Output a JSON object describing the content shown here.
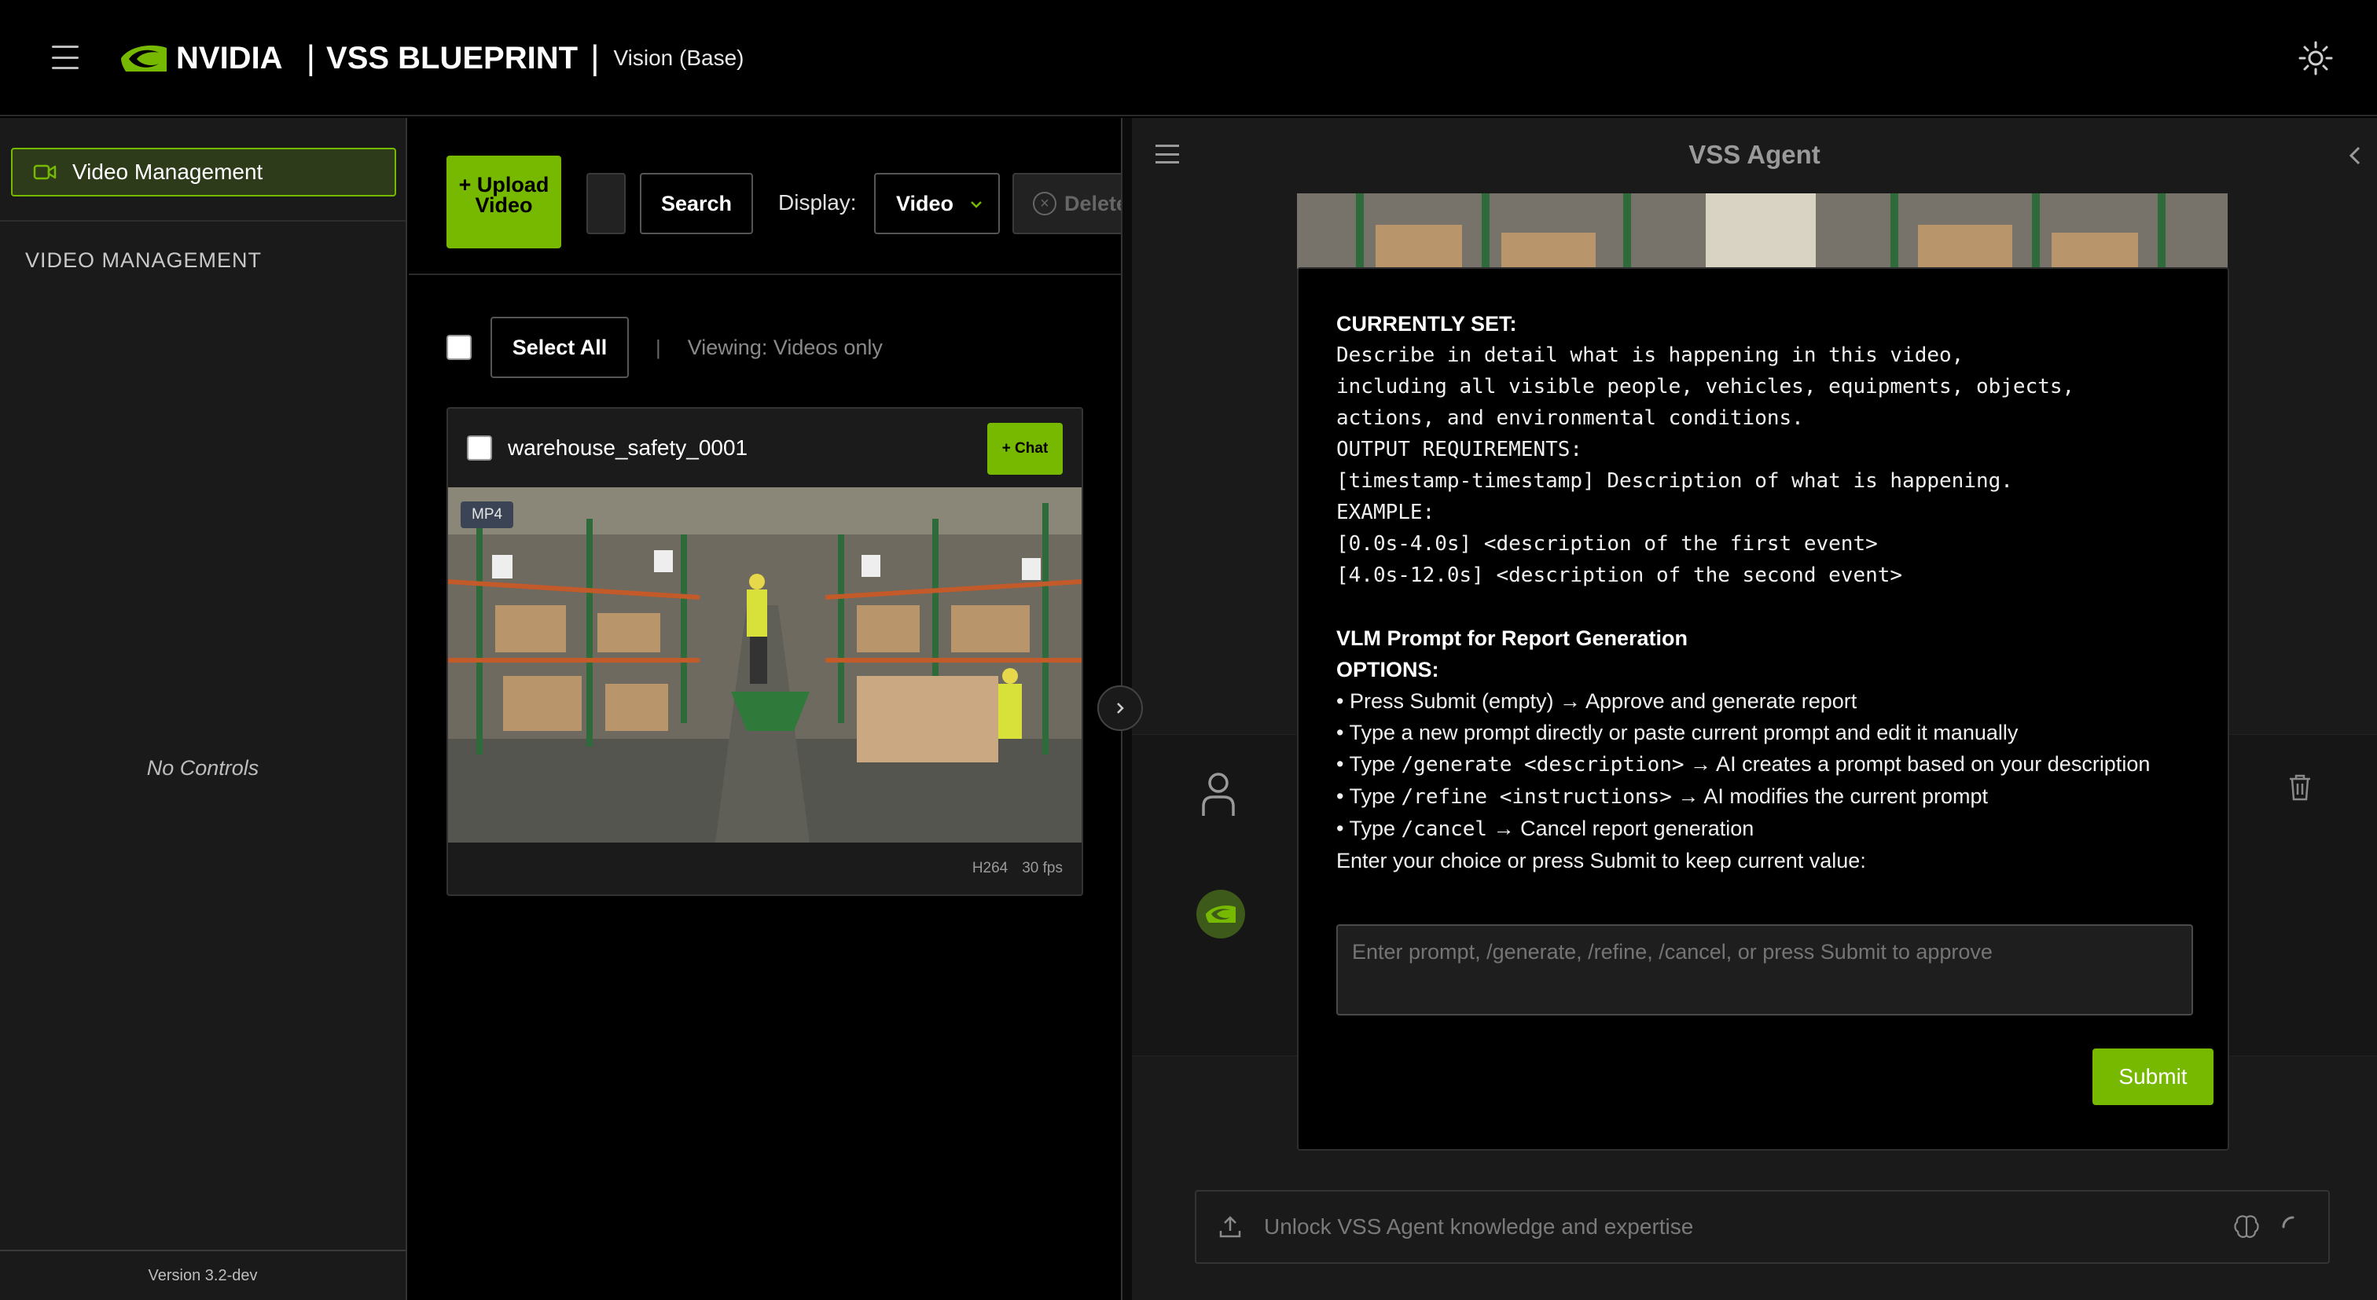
{
  "header": {
    "brand": "NVIDIA",
    "blueprint_title": "VSS BLUEPRINT",
    "subtitle": "Vision (Base)"
  },
  "sidebar": {
    "nav_item": "Video Management",
    "section_title": "VIDEO MANAGEMENT",
    "empty_text": "No Controls",
    "version": "Version 3.2-dev"
  },
  "toolbar": {
    "upload_label": "+ Upload Video",
    "search_label": "Search",
    "display_label": "Display:",
    "display_value": "Video",
    "delete_label": "Delete"
  },
  "selection": {
    "select_all_label": "Select All",
    "separator": "|",
    "viewing_text": "Viewing: Videos only"
  },
  "video_card": {
    "name": "warehouse_safety_0001",
    "chat_label": "+ Chat",
    "format_badge": "MP4",
    "codec": "H264",
    "fps": "30 fps"
  },
  "chat": {
    "title": "VSS Agent",
    "currently_set_heading": "CURRENTLY SET:",
    "prompt_lines": [
      "Describe in detail what is happening in this video,",
      "including all visible people, vehicles, equipments, objects,",
      "actions, and environmental conditions.",
      "OUTPUT REQUIREMENTS:",
      "[timestamp-timestamp] Description of what is happening.",
      "EXAMPLE:",
      "[0.0s-4.0s] <description of the first event>",
      "[4.0s-12.0s] <description of the second event>"
    ],
    "report_heading": "VLM Prompt for Report Generation",
    "options_heading": "OPTIONS:",
    "options": {
      "opt1": "• Press Submit (empty) → Approve and generate report",
      "opt2": "• Type a new prompt directly or paste current prompt and edit it manually",
      "opt3_prefix": "• Type ",
      "opt3_code": "/generate <description>",
      "opt3_suffix": " → AI creates a prompt based on your description",
      "opt4_prefix": "• Type ",
      "opt4_code": "/refine <instructions>",
      "opt4_suffix": " → AI modifies the current prompt",
      "opt5_prefix": "• Type ",
      "opt5_code": "/cancel",
      "opt5_suffix": " → Cancel report generation"
    },
    "choice_text": "Enter your choice or press Submit to keep current value:",
    "prompt_placeholder": "Enter prompt, /generate, /refine, /cancel, or press Submit to approve",
    "submit_label": "Submit",
    "input_placeholder": "Unlock VSS Agent knowledge and expertise"
  },
  "colors": {
    "accent": "#76b900",
    "background": "#000000",
    "panel": "#1a1a1a"
  }
}
